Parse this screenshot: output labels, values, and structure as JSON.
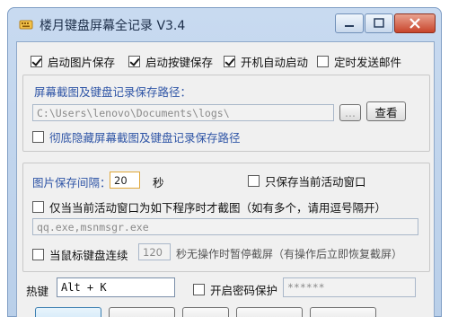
{
  "window": {
    "title": "楼月键盘屏幕全记录 V3.4"
  },
  "options": {
    "start_screenshot_save": "启动图片保存",
    "start_keyboard_save": "启动按键保存",
    "autostart": "开机自动启动",
    "timed_email": "定时发送邮件"
  },
  "path_group": {
    "label": "屏幕截图及键盘记录保存路径：",
    "path_value": "C:\\Users\\lenovo\\Documents\\logs\\",
    "browse_label": "...",
    "view_label": "查看",
    "hide_path": "彻底隐藏屏幕截图及键盘记录保存路径"
  },
  "capture_group": {
    "interval_label": "图片保存间隔：",
    "interval_value": "20",
    "interval_unit": "秒",
    "active_window_only": "只保存当前活动窗口",
    "program_only": "仅当当前活动窗口为如下程序时才截图（如有多个，请用逗号隔开）",
    "program_list": "qq.exe,msnmsgr.exe",
    "pause_prefix": "当鼠标键盘连续",
    "pause_value": "120",
    "pause_suffix": "秒无操作时暂停截屏（有操作后立即恢复截屏）"
  },
  "hotkey": {
    "label": "热键",
    "value": "Alt + K",
    "password_protect": "开启密码保护",
    "password_value": "******"
  },
  "colors": {
    "label_blue": "#2f55a6",
    "title_bg": "#c8daf0"
  }
}
